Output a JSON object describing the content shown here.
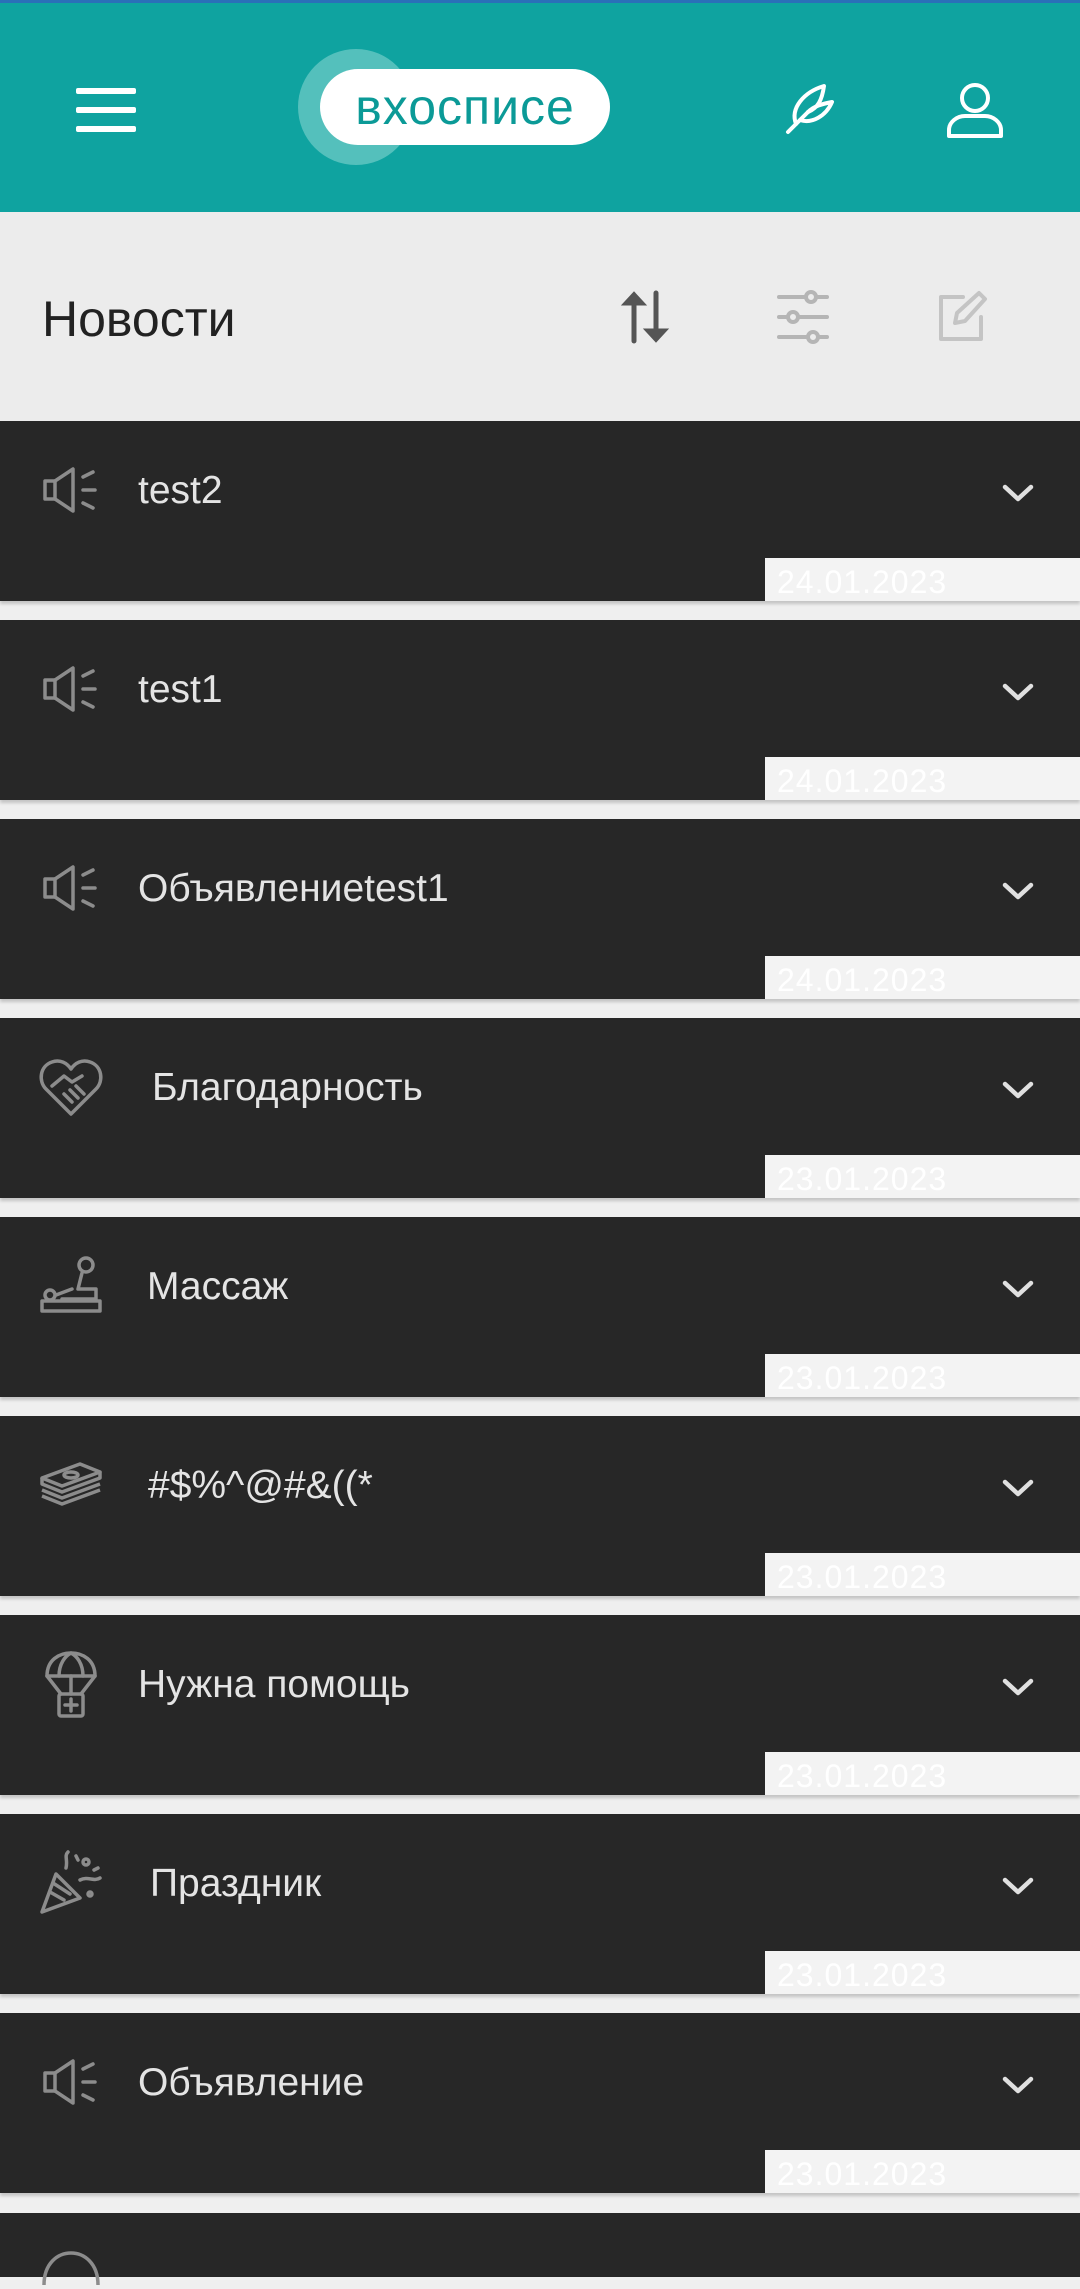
{
  "app": {
    "logo_text": "вхосписе",
    "colors": {
      "primary": "#0fa3a0",
      "card_bg": "#272727",
      "page_bg": "#ececec"
    }
  },
  "header_icons": {
    "menu": "hamburger-icon",
    "wishes": "wish-feather-icon",
    "profile": "user-icon"
  },
  "page": {
    "title": "Новости",
    "actions": [
      "sort-icon",
      "filter-sliders-icon",
      "edit-icon"
    ]
  },
  "news": [
    {
      "icon": "megaphone-icon",
      "title": "test2",
      "date": "24.01.2023"
    },
    {
      "icon": "megaphone-icon",
      "title": "test1",
      "date": "24.01.2023"
    },
    {
      "icon": "megaphone-icon",
      "title": "Объявлениеtest1",
      "date": "24.01.2023"
    },
    {
      "icon": "heart-handshake-icon",
      "title": "Благодарность",
      "date": "23.01.2023"
    },
    {
      "icon": "massage-icon",
      "title": "Массаж",
      "date": "23.01.2023"
    },
    {
      "icon": "money-stack-icon",
      "title": "#$%^@#&((*",
      "date": "23.01.2023"
    },
    {
      "icon": "parachute-help-icon",
      "title": "Нужна помощь",
      "date": "23.01.2023"
    },
    {
      "icon": "party-popper-icon",
      "title": "Праздник",
      "date": "23.01.2023"
    },
    {
      "icon": "megaphone-icon",
      "title": "Объявление",
      "date": "23.01.2023"
    }
  ]
}
